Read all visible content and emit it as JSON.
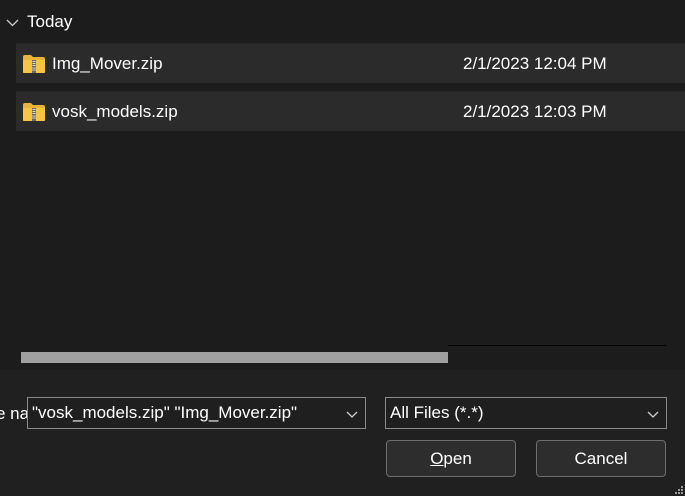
{
  "file_list": {
    "group_label": "Today",
    "rows": [
      {
        "name": "Img_Mover.zip",
        "date": "2/1/2023 12:04 PM"
      },
      {
        "name": "vosk_models.zip",
        "date": "2/1/2023 12:03 PM"
      }
    ]
  },
  "footer": {
    "file_name_label": "File name:",
    "file_name_value": "\"vosk_models.zip\" \"Img_Mover.zip\"",
    "file_type_value": "All Files (*.*)",
    "open_label_first": "O",
    "open_label_rest": "pen",
    "cancel_label": "Cancel"
  },
  "colors": {
    "background": "#1c1c1c",
    "row_background": "#2b2b2b",
    "folder_yellow": "#f5c640",
    "scrollbar_thumb": "#a0a0a0"
  },
  "icons": {
    "group_toggle": "chevron-down-icon",
    "file": "zip-folder-icon",
    "dropdown": "chevron-down-icon"
  }
}
